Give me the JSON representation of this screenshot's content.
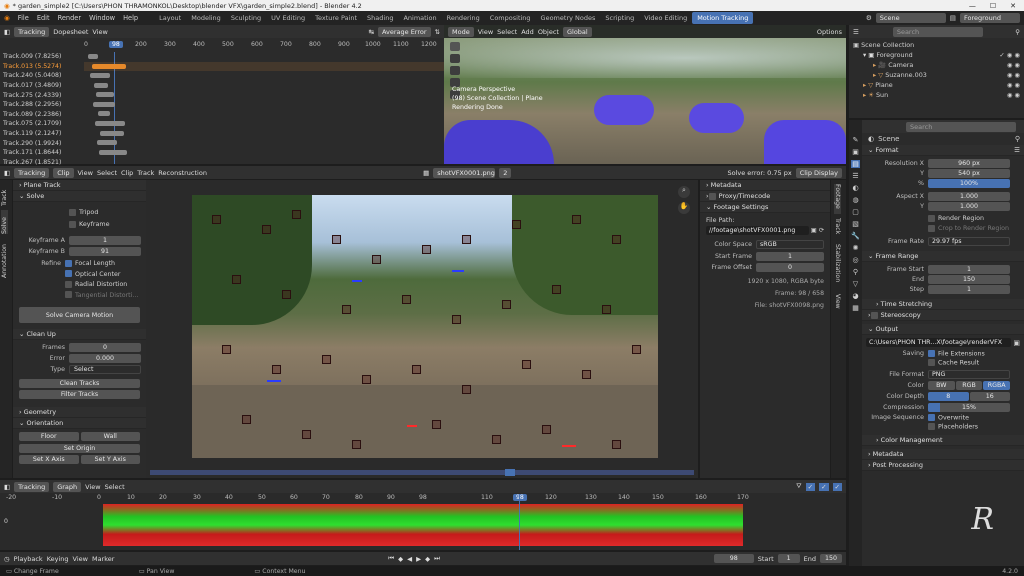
{
  "title_bar": {
    "text": "* garden_simple2 [C:\\Users\\PHON THRAMONKOL\\Desktop\\blender VFX\\garden_simple2.blend] - Blender 4.2"
  },
  "menu": [
    "File",
    "Edit",
    "Render",
    "Window",
    "Help"
  ],
  "workspaces": [
    "Layout",
    "Modeling",
    "Sculpting",
    "UV Editing",
    "Texture Paint",
    "Shading",
    "Animation",
    "Rendering",
    "Compositing",
    "Geometry Nodes",
    "Scripting",
    "Video Editing",
    "Motion Tracking"
  ],
  "active_workspace": "Motion Tracking",
  "scene": "Scene",
  "view_layer": "Foreground",
  "dopesheet": {
    "mode": "Tracking",
    "view": "Dopesheet",
    "view_menu": "View",
    "average_error": "Average Error",
    "frame": "98",
    "ruler": [
      "0",
      "100",
      "200",
      "300",
      "400",
      "500",
      "600",
      "700",
      "800",
      "900",
      "1000",
      "1100",
      "1200"
    ],
    "tracks": [
      "Track.009 (7.8256)",
      "Track.013 (5.5274)",
      "Track.240 (5.0408)",
      "Track.017 (3.4809)",
      "Track.275 (2.4339)",
      "Track.288 (2.2956)",
      "Track.089 (2.2386)",
      "Track.075 (2.1709)",
      "Track.119 (2.1247)",
      "Track.290 (1.9924)",
      "Track.171 (1.8644)",
      "Track.267 (1.8521)"
    ]
  },
  "viewport": {
    "menus": [
      "Mode",
      "View",
      "Select",
      "Add",
      "Object"
    ],
    "orientation": "Global",
    "options": "Options",
    "overlay_lines": [
      "Camera Perspective",
      "(98) Scene Collection | Plane",
      "Rendering Done"
    ]
  },
  "clip_editor": {
    "mode": "Tracking",
    "view_type": "Clip",
    "menus": [
      "View",
      "Select",
      "Clip",
      "Track",
      "Reconstruction"
    ],
    "clip_name": "shotVFX0001.png",
    "users": "2",
    "solve_error": "Solve error: 0.75 px",
    "display": "Clip Display"
  },
  "left_tabs": [
    "Track",
    "Solve",
    "Annotation"
  ],
  "right_tabs": [
    "Footage",
    "Track",
    "Stabilization",
    "View"
  ],
  "tool_panel": {
    "plane_track": "Plane Track",
    "solve": "Solve",
    "tripod": "Tripod",
    "keyframe": "Keyframe",
    "keyframe_a_label": "Keyframe A",
    "keyframe_a": "1",
    "keyframe_b_label": "Keyframe B",
    "keyframe_b": "91",
    "refine_label": "Refine",
    "focal_length": "Focal Length",
    "optical_center": "Optical Center",
    "radial_distortion": "Radial Distortion",
    "tangential": "Tangential Distorti...",
    "solve_button": "Solve Camera Motion",
    "cleanup": "Clean Up",
    "frames_label": "Frames",
    "frames": "0",
    "error_label": "Error",
    "error": "0.000",
    "type_label": "Type",
    "type": "Select",
    "clean_tracks": "Clean Tracks",
    "filter_tracks": "Filter Tracks",
    "geometry": "Geometry",
    "orientation": "Orientation",
    "floor": "Floor",
    "wall": "Wall",
    "set_origin": "Set Origin",
    "set_x": "Set X Axis",
    "set_y": "Set Y Axis"
  },
  "footage_panel": {
    "metadata": "Metadata",
    "proxy": "Proxy/Timecode",
    "footage_settings": "Footage Settings",
    "file_path_label": "File Path:",
    "file_path": "//footage\\shotVFX0001.png",
    "color_space_label": "Color Space",
    "color_space": "sRGB",
    "start_frame_label": "Start Frame",
    "start_frame": "1",
    "frame_offset_label": "Frame Offset",
    "frame_offset": "0",
    "info1": "1920 x 1080, RGBA byte",
    "info2": "Frame: 98 / 658",
    "info3": "File: shotVFX0098.png"
  },
  "graph_editor": {
    "mode": "Tracking",
    "view_type": "Graph",
    "menus": [
      "View",
      "Select"
    ],
    "ruler": [
      "-20",
      "-10",
      "0",
      "10",
      "20",
      "30",
      "40",
      "50",
      "60",
      "70",
      "80",
      "90",
      "98",
      "100",
      "110",
      "120",
      "130",
      "140",
      "150",
      "160",
      "170"
    ],
    "frame": "98",
    "y_label": "0"
  },
  "outliner": {
    "search": "Search",
    "collection": "Scene Collection",
    "items": [
      {
        "name": "Foreground",
        "level": 1
      },
      {
        "name": "Camera",
        "level": 2
      },
      {
        "name": "Suzanne.003",
        "level": 2
      },
      {
        "name": "Plane",
        "level": 1
      },
      {
        "name": "Sun",
        "level": 1
      }
    ]
  },
  "properties": {
    "search": "Search",
    "scene": "Scene",
    "format": "Format",
    "res_x_label": "Resolution X",
    "res_x": "960 px",
    "res_y_label": "Y",
    "res_y": "540 px",
    "pct_label": "%",
    "pct": "100%",
    "aspect_x_label": "Aspect X",
    "aspect_x": "1.000",
    "aspect_y_label": "Y",
    "aspect_y": "1.000",
    "render_region": "Render Region",
    "crop": "Crop to Render Region",
    "frame_rate_label": "Frame Rate",
    "frame_rate": "29.97 fps",
    "frame_range": "Frame Range",
    "frame_start_label": "Frame Start",
    "frame_start": "1",
    "end_label": "End",
    "end": "150",
    "step_label": "Step",
    "step": "1",
    "time_stretching": "Time Stretching",
    "stereoscopy": "Stereoscopy",
    "output": "Output",
    "output_path": "C:\\Users\\PHON THR...X\\footage\\renderVFX",
    "saving_label": "Saving",
    "file_extensions": "File Extensions",
    "cache_result": "Cache Result",
    "file_format_label": "File Format",
    "file_format": "PNG",
    "color_label": "Color",
    "bw": "BW",
    "rgb": "RGB",
    "rgba": "RGBA",
    "depth_label": "Color Depth",
    "depth8": "8",
    "depth16": "16",
    "compression_label": "Compression",
    "compression": "15%",
    "image_sequence_label": "Image Sequence",
    "overwrite": "Overwrite",
    "placeholders": "Placeholders",
    "color_management": "Color Management",
    "metadata": "Metadata",
    "post_processing": "Post Processing"
  },
  "timeline": {
    "playback": "Playback",
    "keying": "Keying",
    "view": "View",
    "marker": "Marker",
    "frame": "98",
    "start_label": "Start",
    "start": "1",
    "end_label": "End",
    "end": "150"
  },
  "status_bar": {
    "change_frame": "Change Frame",
    "pan_view": "Pan View",
    "context_menu": "Context Menu",
    "version": "4.2.0"
  },
  "progress": {
    "compression_fraction": 0.15
  }
}
